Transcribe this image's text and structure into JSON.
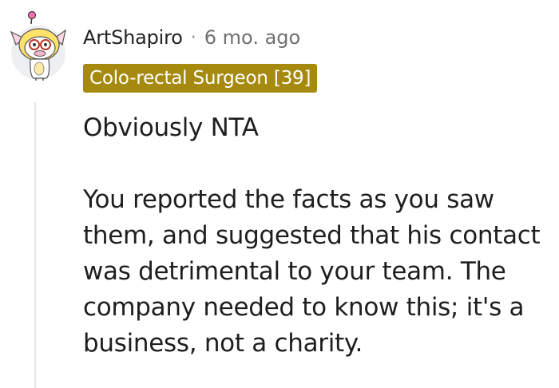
{
  "comment": {
    "username": "ArtShapiro",
    "separator": "·",
    "timestamp": "6 mo. ago",
    "flair": "Colo-rectal Surgeon [39]",
    "paragraphs": [
      "Obviously NTA",
      "You reported the facts as you saw them, and suggested that his contact was detrimental to your team. The company needed to know this; it's a business, not a charity."
    ]
  },
  "colors": {
    "flair_background": "#a58a0f",
    "flair_text": "#ffffff",
    "thread_line": "#e5e5e5",
    "avatar_background": "#edeff1"
  },
  "icons": {
    "avatar": "snoo-avatar-icon"
  }
}
